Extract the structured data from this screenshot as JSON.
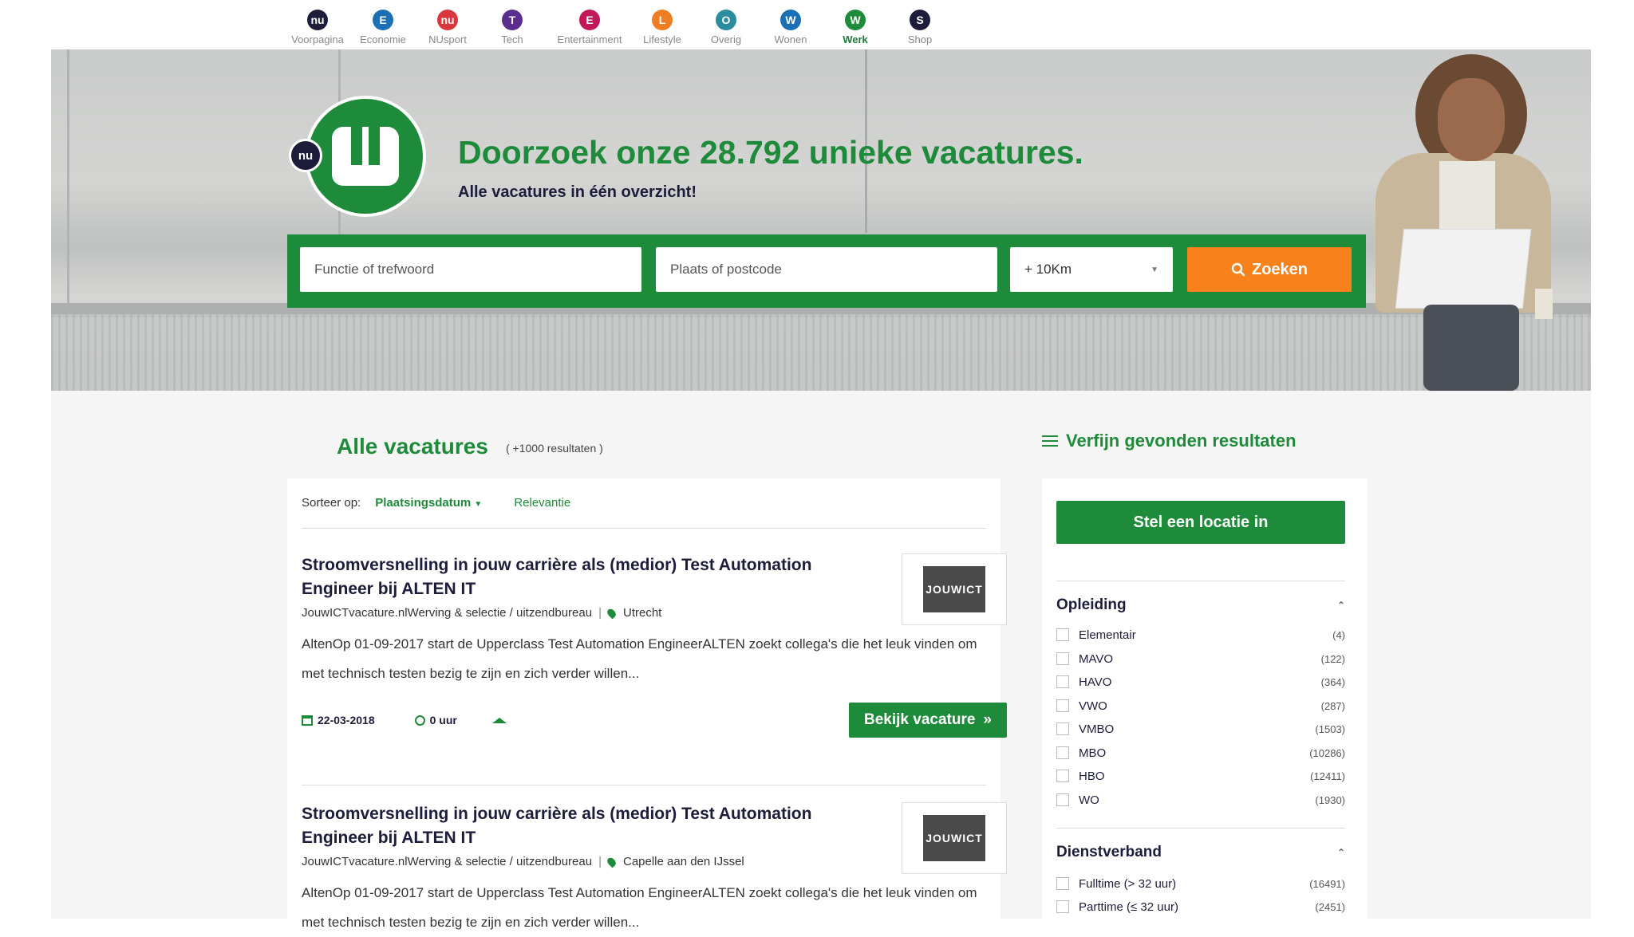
{
  "nav": {
    "items": [
      {
        "label": "Voorpagina",
        "badge": "nu",
        "color": "#1d1d3b"
      },
      {
        "label": "Economie",
        "badge": "E",
        "color": "#1a6fb5"
      },
      {
        "label": "NUsport",
        "badge": "nu",
        "color": "#d9363e"
      },
      {
        "label": "Tech",
        "badge": "T",
        "color": "#5b2d8e"
      },
      {
        "label": "Entertainment",
        "badge": "E",
        "color": "#c2185b"
      },
      {
        "label": "Lifestyle",
        "badge": "L",
        "color": "#ef7d22"
      },
      {
        "label": "Overig",
        "badge": "O",
        "color": "#2a8c9c"
      },
      {
        "label": "Wonen",
        "badge": "W",
        "color": "#1a6fb5"
      },
      {
        "label": "Werk",
        "badge": "W",
        "color": "#1e8b3a",
        "active": true
      },
      {
        "label": "Shop",
        "badge": "S",
        "color": "#1d1d3b"
      }
    ]
  },
  "hero": {
    "logo_small": "nu",
    "title": "Doorzoek onze 28.792 unieke vacatures.",
    "subtitle": "Alle vacatures in één overzicht!"
  },
  "search": {
    "keyword_placeholder": "Functie of trefwoord",
    "location_placeholder": "Plaats of postcode",
    "radius": "+ 10Km",
    "button": "Zoeken"
  },
  "results": {
    "title": "Alle vacatures",
    "count": "( +1000 resultaten )",
    "sort_label": "Sorteer op:",
    "sort_active": "Plaatsingsdatum",
    "sort_other": "Relevantie"
  },
  "jobs": [
    {
      "title": "Stroomversnelling in jouw carrière als (medior) Test Automation Engineer bij ALTEN IT",
      "company": "JouwICTvacature.nlWerving & selectie / uitzendbureau",
      "location": "Utrecht",
      "description": "AltenOp 01-09-2017 start de Upperclass Test Automation EngineerALTEN zoekt collega's die het leuk vinden om met technisch testen bezig te zijn en zich verder willen...",
      "date": "22-03-2018",
      "hours": "0 uur",
      "logo": "JOUWICT",
      "button": "Bekijk vacature"
    },
    {
      "title": "Stroomversnelling in jouw carrière als (medior) Test Automation Engineer bij ALTEN IT",
      "company": "JouwICTvacature.nlWerving & selectie / uitzendbureau",
      "location": "Capelle aan den IJssel",
      "description": "AltenOp 01-09-2017 start de Upperclass Test Automation EngineerALTEN zoekt collega's die het leuk vinden om met technisch testen bezig te zijn en zich verder willen...",
      "logo": "JOUWICT"
    }
  ],
  "filters": {
    "title": "Verfijn gevonden resultaten",
    "location_button": "Stel een locatie in",
    "education": {
      "title": "Opleiding",
      "options": [
        {
          "label": "Elementair",
          "count": "(4)"
        },
        {
          "label": "MAVO",
          "count": "(122)"
        },
        {
          "label": "HAVO",
          "count": "(364)"
        },
        {
          "label": "VWO",
          "count": "(287)"
        },
        {
          "label": "VMBO",
          "count": "(1503)"
        },
        {
          "label": "MBO",
          "count": "(10286)"
        },
        {
          "label": "HBO",
          "count": "(12411)"
        },
        {
          "label": "WO",
          "count": "(1930)"
        }
      ]
    },
    "employment": {
      "title": "Dienstverband",
      "options": [
        {
          "label": "Fulltime (> 32 uur)",
          "count": "(16491)"
        },
        {
          "label": "Parttime (≤ 32 uur)",
          "count": "(2451)"
        }
      ]
    }
  }
}
